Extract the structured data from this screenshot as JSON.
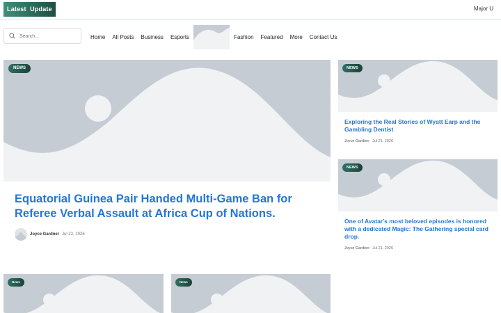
{
  "topbar": {
    "latest_label": "Latest  Update",
    "ticker_text": "Major U"
  },
  "search": {
    "placeholder": "Search..."
  },
  "nav": {
    "items_left": [
      "Home",
      "All Posts",
      "Business",
      "Esports"
    ],
    "items_right": [
      "Fashion",
      "Featured",
      "More",
      "Contact Us"
    ]
  },
  "featured": {
    "tag": "NEWS",
    "title": "Equatorial Guinea Pair Handed Multi-Game Ban for Referee Verbal Assault at Africa Cup of Nations.",
    "author": "Joyce Gardner",
    "date": "Jul 22, 2026"
  },
  "side_articles": [
    {
      "tag": "NEWS",
      "title": "Exploring the Real Stories of Wyatt Earp and the Gambling Dentist",
      "author": "Joyce Gardner",
      "date": "Jul 21, 2026"
    },
    {
      "tag": "NEWS",
      "title": "One of Avatar's most beloved episodes is honored with a dedicated Magic: The Gathering special card drop.",
      "author": "Joyce Gardner",
      "date": "Jul 21, 2026"
    }
  ],
  "bottom_cards": [
    {
      "tag": "News"
    },
    {
      "tag": "News"
    }
  ],
  "colors": {
    "accent_blue": "#2377d4",
    "tag_green": "#2f7062",
    "placeholder_bg": "#c5ccd4"
  }
}
